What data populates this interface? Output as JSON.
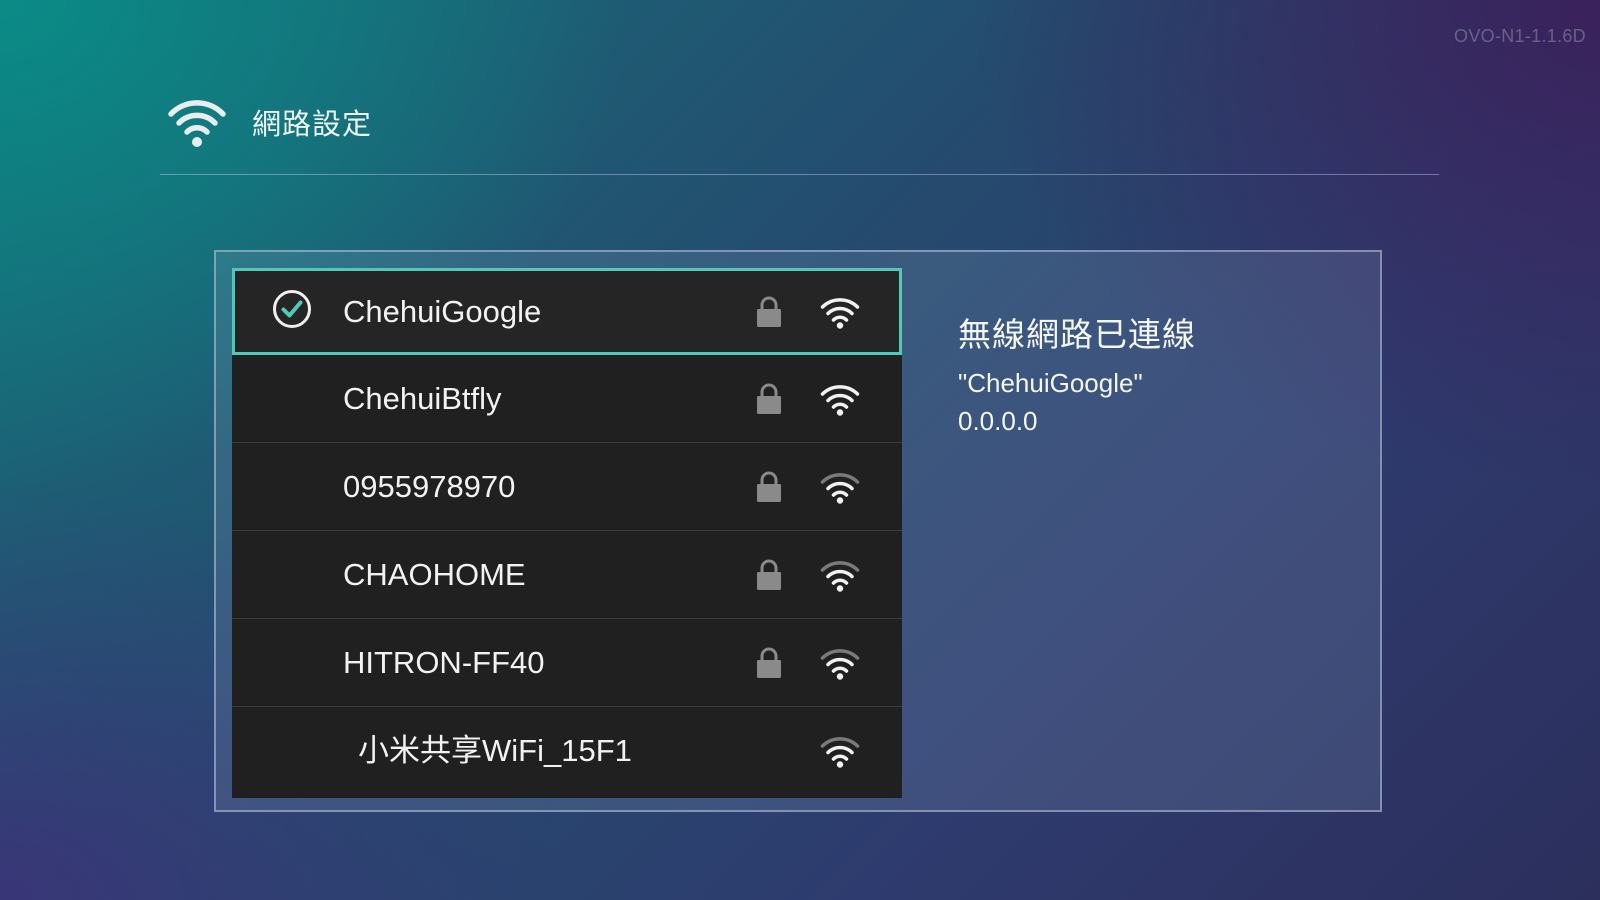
{
  "version": "OVO-N1-1.1.6D",
  "header": {
    "icon": "wifi-icon",
    "title": "網路設定"
  },
  "networks": [
    {
      "name": "ChehuiGoogle",
      "connected": true,
      "secured": true,
      "signal": "full"
    },
    {
      "name": "ChehuiBtfly",
      "connected": false,
      "secured": true,
      "signal": "full"
    },
    {
      "name": "0955978970",
      "connected": false,
      "secured": true,
      "signal": "medium"
    },
    {
      "name": "CHAOHOME",
      "connected": false,
      "secured": true,
      "signal": "medium"
    },
    {
      "name": "HITRON-FF40",
      "connected": false,
      "secured": true,
      "signal": "medium"
    },
    {
      "name": "小米共享WiFi_15F1",
      "connected": false,
      "secured": false,
      "signal": "medium"
    }
  ],
  "status": {
    "title": "無線網路已連線",
    "ssid": "\"ChehuiGoogle\"",
    "ip": "0.0.0.0"
  },
  "colors": {
    "accent": "#52c9b8",
    "list_bg": "#202020",
    "lock": "#8a8a8a"
  }
}
